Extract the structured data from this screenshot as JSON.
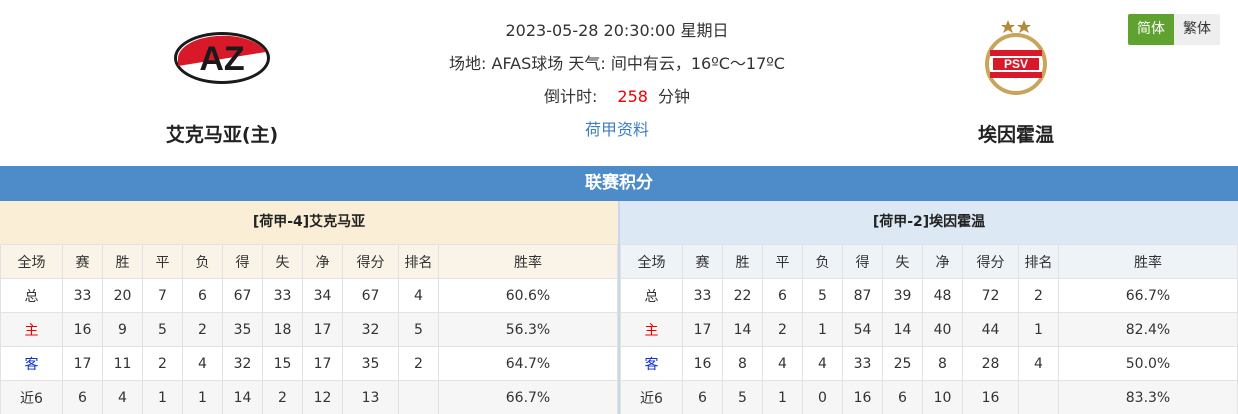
{
  "match": {
    "datetime": "2023-05-28 20:30:00 星期日",
    "venue_line": "场地: AFAS球场 天气: 间中有云，16ºC～17ºC",
    "countdown_label": "倒计时:",
    "countdown_value": "258",
    "countdown_unit": "分钟",
    "league_link": "荷甲资料"
  },
  "home_team": {
    "name": "艾克马亚(主)",
    "logo_icon": "az-club-crest",
    "logo_text": "AZ"
  },
  "away_team": {
    "name": "埃因霍温",
    "logo_icon": "psv-club-crest",
    "logo_text": "PSV"
  },
  "lang_toggle": {
    "simplified": "简体",
    "traditional": "繁体"
  },
  "section_title": "联赛积分",
  "columns": [
    "全场",
    "赛",
    "胜",
    "平",
    "负",
    "得",
    "失",
    "净",
    "得分",
    "排名",
    "胜率"
  ],
  "home_table": {
    "title": "[荷甲-4]艾克马亚",
    "rows": [
      [
        "总",
        "33",
        "20",
        "7",
        "6",
        "67",
        "33",
        "34",
        "67",
        "4",
        "60.6%"
      ],
      [
        "主",
        "16",
        "9",
        "5",
        "2",
        "35",
        "18",
        "17",
        "32",
        "5",
        "56.3%"
      ],
      [
        "客",
        "17",
        "11",
        "2",
        "4",
        "32",
        "15",
        "17",
        "35",
        "2",
        "64.7%"
      ],
      [
        "近6",
        "6",
        "4",
        "1",
        "1",
        "14",
        "2",
        "12",
        "13",
        "",
        "66.7%"
      ]
    ]
  },
  "away_table": {
    "title": "[荷甲-2]埃因霍温",
    "rows": [
      [
        "总",
        "33",
        "22",
        "6",
        "5",
        "87",
        "39",
        "48",
        "72",
        "2",
        "66.7%"
      ],
      [
        "主",
        "17",
        "14",
        "2",
        "1",
        "54",
        "14",
        "40",
        "44",
        "1",
        "82.4%"
      ],
      [
        "客",
        "16",
        "8",
        "4",
        "4",
        "33",
        "25",
        "8",
        "28",
        "4",
        "50.0%"
      ],
      [
        "近6",
        "6",
        "5",
        "1",
        "0",
        "16",
        "6",
        "10",
        "16",
        "",
        "83.3%"
      ]
    ]
  },
  "colors": {
    "accent_blue": "#4d8cc8",
    "active_green": "#5fa22f",
    "home_red": "#e00000",
    "away_blue": "#1030c0"
  }
}
